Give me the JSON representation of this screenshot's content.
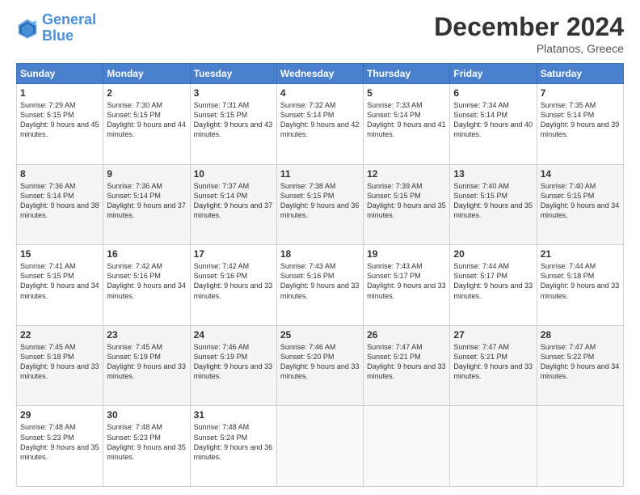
{
  "header": {
    "logo_line1": "General",
    "logo_line2": "Blue",
    "month": "December 2024",
    "location": "Platanos, Greece"
  },
  "weekdays": [
    "Sunday",
    "Monday",
    "Tuesday",
    "Wednesday",
    "Thursday",
    "Friday",
    "Saturday"
  ],
  "weeks": [
    [
      {
        "day": "1",
        "sunrise": "Sunrise: 7:29 AM",
        "sunset": "Sunset: 5:15 PM",
        "daylight": "Daylight: 9 hours and 45 minutes."
      },
      {
        "day": "2",
        "sunrise": "Sunrise: 7:30 AM",
        "sunset": "Sunset: 5:15 PM",
        "daylight": "Daylight: 9 hours and 44 minutes."
      },
      {
        "day": "3",
        "sunrise": "Sunrise: 7:31 AM",
        "sunset": "Sunset: 5:15 PM",
        "daylight": "Daylight: 9 hours and 43 minutes."
      },
      {
        "day": "4",
        "sunrise": "Sunrise: 7:32 AM",
        "sunset": "Sunset: 5:14 PM",
        "daylight": "Daylight: 9 hours and 42 minutes."
      },
      {
        "day": "5",
        "sunrise": "Sunrise: 7:33 AM",
        "sunset": "Sunset: 5:14 PM",
        "daylight": "Daylight: 9 hours and 41 minutes."
      },
      {
        "day": "6",
        "sunrise": "Sunrise: 7:34 AM",
        "sunset": "Sunset: 5:14 PM",
        "daylight": "Daylight: 9 hours and 40 minutes."
      },
      {
        "day": "7",
        "sunrise": "Sunrise: 7:35 AM",
        "sunset": "Sunset: 5:14 PM",
        "daylight": "Daylight: 9 hours and 39 minutes."
      }
    ],
    [
      {
        "day": "8",
        "sunrise": "Sunrise: 7:36 AM",
        "sunset": "Sunset: 5:14 PM",
        "daylight": "Daylight: 9 hours and 38 minutes."
      },
      {
        "day": "9",
        "sunrise": "Sunrise: 7:36 AM",
        "sunset": "Sunset: 5:14 PM",
        "daylight": "Daylight: 9 hours and 37 minutes."
      },
      {
        "day": "10",
        "sunrise": "Sunrise: 7:37 AM",
        "sunset": "Sunset: 5:14 PM",
        "daylight": "Daylight: 9 hours and 37 minutes."
      },
      {
        "day": "11",
        "sunrise": "Sunrise: 7:38 AM",
        "sunset": "Sunset: 5:15 PM",
        "daylight": "Daylight: 9 hours and 36 minutes."
      },
      {
        "day": "12",
        "sunrise": "Sunrise: 7:39 AM",
        "sunset": "Sunset: 5:15 PM",
        "daylight": "Daylight: 9 hours and 35 minutes."
      },
      {
        "day": "13",
        "sunrise": "Sunrise: 7:40 AM",
        "sunset": "Sunset: 5:15 PM",
        "daylight": "Daylight: 9 hours and 35 minutes."
      },
      {
        "day": "14",
        "sunrise": "Sunrise: 7:40 AM",
        "sunset": "Sunset: 5:15 PM",
        "daylight": "Daylight: 9 hours and 34 minutes."
      }
    ],
    [
      {
        "day": "15",
        "sunrise": "Sunrise: 7:41 AM",
        "sunset": "Sunset: 5:15 PM",
        "daylight": "Daylight: 9 hours and 34 minutes."
      },
      {
        "day": "16",
        "sunrise": "Sunrise: 7:42 AM",
        "sunset": "Sunset: 5:16 PM",
        "daylight": "Daylight: 9 hours and 34 minutes."
      },
      {
        "day": "17",
        "sunrise": "Sunrise: 7:42 AM",
        "sunset": "Sunset: 5:16 PM",
        "daylight": "Daylight: 9 hours and 33 minutes."
      },
      {
        "day": "18",
        "sunrise": "Sunrise: 7:43 AM",
        "sunset": "Sunset: 5:16 PM",
        "daylight": "Daylight: 9 hours and 33 minutes."
      },
      {
        "day": "19",
        "sunrise": "Sunrise: 7:43 AM",
        "sunset": "Sunset: 5:17 PM",
        "daylight": "Daylight: 9 hours and 33 minutes."
      },
      {
        "day": "20",
        "sunrise": "Sunrise: 7:44 AM",
        "sunset": "Sunset: 5:17 PM",
        "daylight": "Daylight: 9 hours and 33 minutes."
      },
      {
        "day": "21",
        "sunrise": "Sunrise: 7:44 AM",
        "sunset": "Sunset: 5:18 PM",
        "daylight": "Daylight: 9 hours and 33 minutes."
      }
    ],
    [
      {
        "day": "22",
        "sunrise": "Sunrise: 7:45 AM",
        "sunset": "Sunset: 5:18 PM",
        "daylight": "Daylight: 9 hours and 33 minutes."
      },
      {
        "day": "23",
        "sunrise": "Sunrise: 7:45 AM",
        "sunset": "Sunset: 5:19 PM",
        "daylight": "Daylight: 9 hours and 33 minutes."
      },
      {
        "day": "24",
        "sunrise": "Sunrise: 7:46 AM",
        "sunset": "Sunset: 5:19 PM",
        "daylight": "Daylight: 9 hours and 33 minutes."
      },
      {
        "day": "25",
        "sunrise": "Sunrise: 7:46 AM",
        "sunset": "Sunset: 5:20 PM",
        "daylight": "Daylight: 9 hours and 33 minutes."
      },
      {
        "day": "26",
        "sunrise": "Sunrise: 7:47 AM",
        "sunset": "Sunset: 5:21 PM",
        "daylight": "Daylight: 9 hours and 33 minutes."
      },
      {
        "day": "27",
        "sunrise": "Sunrise: 7:47 AM",
        "sunset": "Sunset: 5:21 PM",
        "daylight": "Daylight: 9 hours and 33 minutes."
      },
      {
        "day": "28",
        "sunrise": "Sunrise: 7:47 AM",
        "sunset": "Sunset: 5:22 PM",
        "daylight": "Daylight: 9 hours and 34 minutes."
      }
    ],
    [
      {
        "day": "29",
        "sunrise": "Sunrise: 7:48 AM",
        "sunset": "Sunset: 5:23 PM",
        "daylight": "Daylight: 9 hours and 35 minutes."
      },
      {
        "day": "30",
        "sunrise": "Sunrise: 7:48 AM",
        "sunset": "Sunset: 5:23 PM",
        "daylight": "Daylight: 9 hours and 35 minutes."
      },
      {
        "day": "31",
        "sunrise": "Sunrise: 7:48 AM",
        "sunset": "Sunset: 5:24 PM",
        "daylight": "Daylight: 9 hours and 36 minutes."
      },
      null,
      null,
      null,
      null
    ]
  ]
}
